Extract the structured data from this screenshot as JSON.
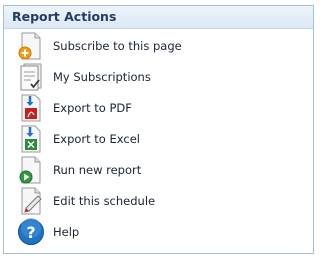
{
  "panel": {
    "title": "Report Actions",
    "items": [
      {
        "label": "Subscribe to this page",
        "icon": "subscribe-page-icon"
      },
      {
        "label": "My Subscriptions",
        "icon": "subscriptions-list-icon"
      },
      {
        "label": "Export to PDF",
        "icon": "export-pdf-icon"
      },
      {
        "label": "Export to Excel",
        "icon": "export-excel-icon"
      },
      {
        "label": "Run new report",
        "icon": "run-report-icon"
      },
      {
        "label": "Edit this schedule",
        "icon": "edit-schedule-icon"
      },
      {
        "label": "Help",
        "icon": "help-icon"
      }
    ]
  },
  "colors": {
    "header_text": "#243c64",
    "border": "#a9bfd6",
    "pdf_red": "#c8201c",
    "excel_green": "#2e8b3c",
    "orange": "#f39c12",
    "help_blue": "#1f73c6"
  }
}
